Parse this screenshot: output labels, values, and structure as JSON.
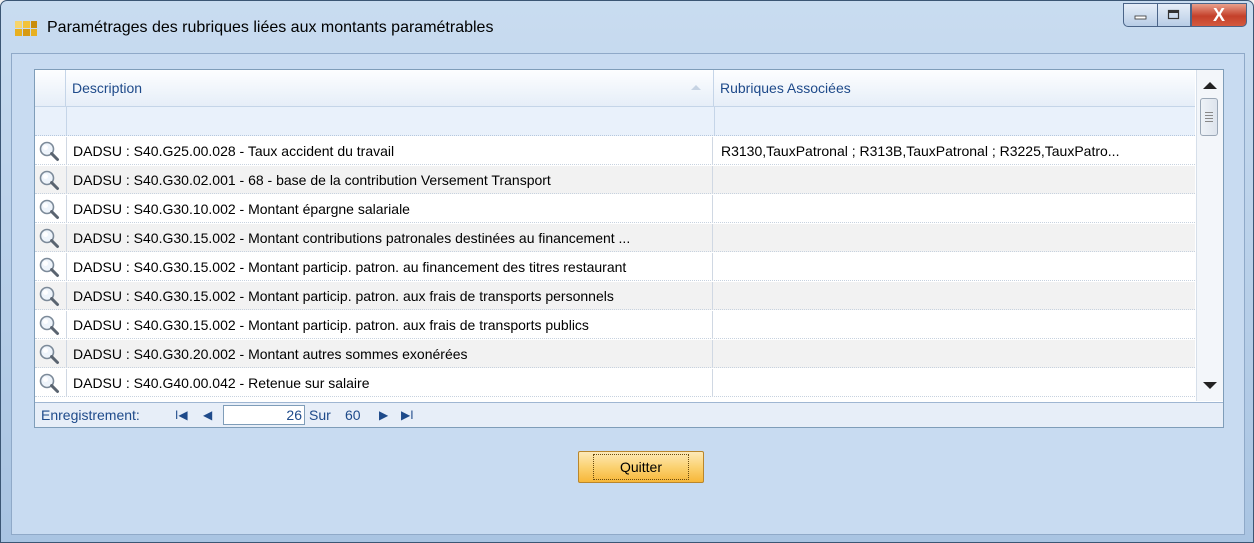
{
  "window": {
    "title": "Paramétrages des rubriques liées aux montants paramétrables",
    "controls": {
      "minimize": "—",
      "maximize": "□",
      "close": "X"
    }
  },
  "grid": {
    "columns": [
      "Description",
      "Rubriques Associées"
    ],
    "rows": [
      {
        "description": "DADSU : S40.G25.00.028 - Taux accident du travail",
        "rubriques": "R3130,TauxPatronal ; R313B,TauxPatronal ; R3225,TauxPatro..."
      },
      {
        "description": "DADSU : S40.G30.02.001 - 68 - base de la contribution Versement Transport",
        "rubriques": ""
      },
      {
        "description": "DADSU : S40.G30.10.002 - Montant épargne salariale",
        "rubriques": ""
      },
      {
        "description": "DADSU : S40.G30.15.002 - Montant contributions patronales destinées au financement ...",
        "rubriques": ""
      },
      {
        "description": "DADSU : S40.G30.15.002 - Montant particip. patron. au financement des titres restaurant",
        "rubriques": ""
      },
      {
        "description": "DADSU : S40.G30.15.002 - Montant particip. patron. aux frais de transports personnels",
        "rubriques": ""
      },
      {
        "description": "DADSU : S40.G30.15.002 - Montant particip. patron. aux frais de transports publics",
        "rubriques": ""
      },
      {
        "description": "DADSU : S40.G30.20.002 - Montant autres sommes exonérées",
        "rubriques": ""
      },
      {
        "description": "DADSU : S40.G40.00.042 - Retenue sur salaire",
        "rubriques": ""
      }
    ],
    "row_icon": "magnifier-icon"
  },
  "navigator": {
    "label": "Enregistrement:",
    "first": "I◀",
    "prev": "◀",
    "position": "26",
    "of_label": "Sur",
    "total": "60",
    "next": "▶",
    "last": "▶I"
  },
  "buttons": {
    "quit": "Quitter"
  },
  "colors": {
    "accent": "#1e4a8a",
    "quit_button": "#fbd272"
  }
}
